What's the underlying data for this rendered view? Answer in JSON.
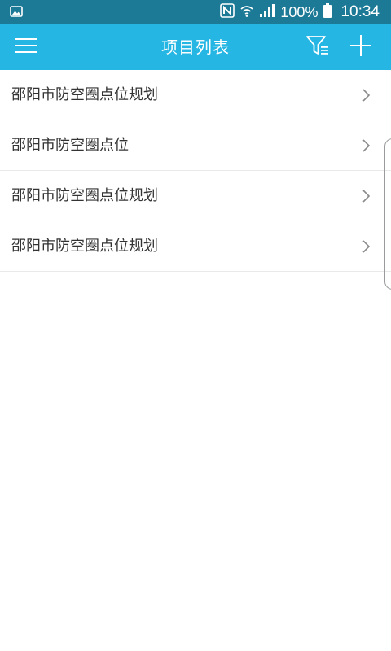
{
  "status_bar": {
    "battery_text": "100%",
    "time": "10:34",
    "icons": [
      "gallery-icon",
      "nfc-icon",
      "wifi-icon",
      "signal-icon",
      "battery-icon"
    ]
  },
  "app_bar": {
    "title": "项目列表",
    "background": "#25b6e3",
    "icons": [
      "menu-icon",
      "filter-icon",
      "add-icon"
    ]
  },
  "projects": [
    {
      "name": "邵阳市防空圈点位规划"
    },
    {
      "name": "邵阳市防空圈点位"
    },
    {
      "name": "邵阳市防空圈点位规划"
    },
    {
      "name": "邵阳市防空圈点位规划"
    }
  ],
  "colors": {
    "status_bar": "#1d7a96",
    "accent": "#25b6e3",
    "text": "#333333"
  }
}
